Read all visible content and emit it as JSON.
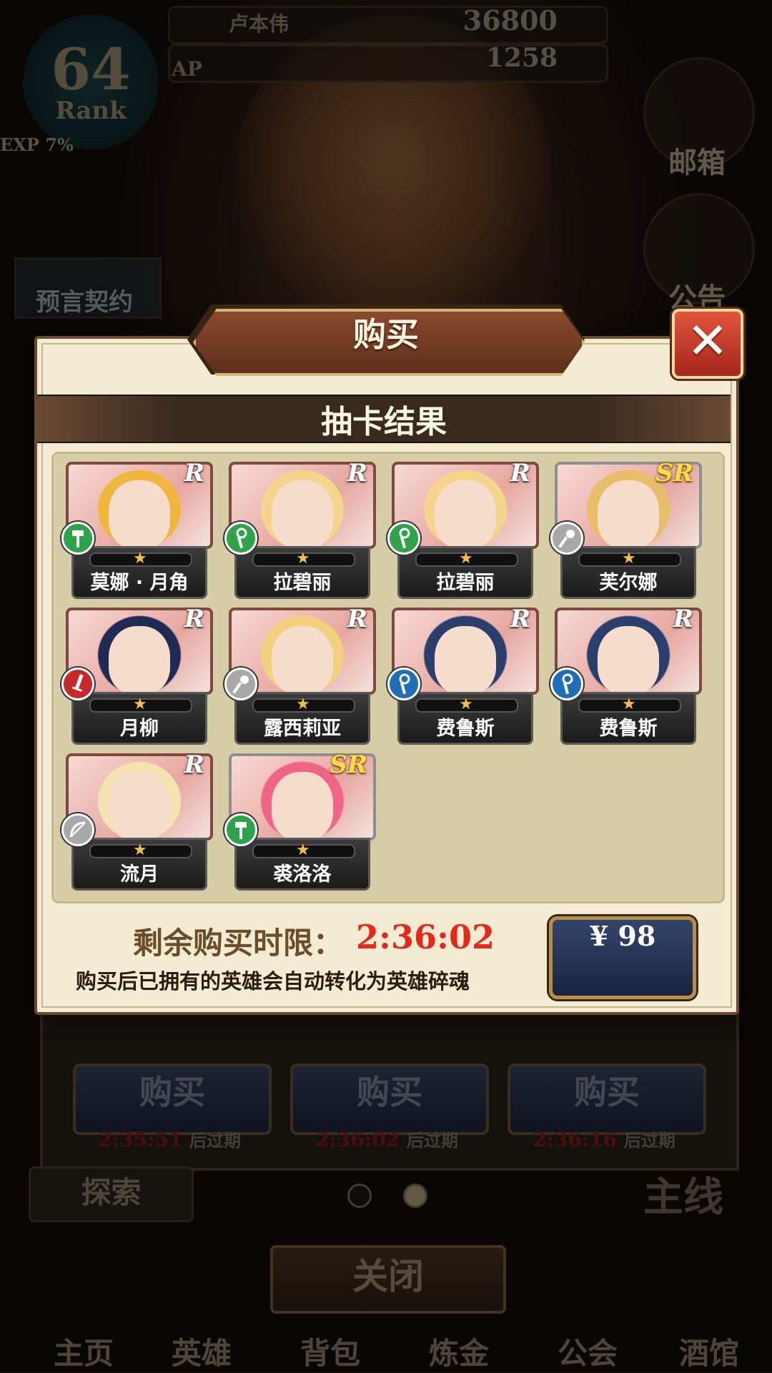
{
  "player": {
    "name": "卢本伟",
    "rank": "64",
    "rank_label": "Rank",
    "exp": "EXP 7%",
    "gold": "36800",
    "gems": "1258",
    "ap_label": "AP"
  },
  "side": {
    "mailbox": "邮箱",
    "notice": "公告",
    "prophecy": "预言契约"
  },
  "dialog": {
    "title": "购买",
    "close_icon": "close-icon",
    "subtitle": "抽卡结果",
    "timer_label": "剩余购买时限：",
    "timer_value": "2:36:02",
    "note": "购买后已拥有的英雄会自动转化为英雄碎魂",
    "price": "¥ 98"
  },
  "cards": [
    {
      "name": "莫娜 · 月角",
      "rarity": "R",
      "class_color": "#2fa34a",
      "class_icon": "hammer-icon",
      "hair": "#f0b63c",
      "stars": 1
    },
    {
      "name": "拉碧丽",
      "rarity": "R",
      "class_color": "#2fa34a",
      "class_icon": "staff-icon",
      "hair": "#f4d58b",
      "stars": 1
    },
    {
      "name": "拉碧丽",
      "rarity": "R",
      "class_color": "#2fa34a",
      "class_icon": "staff-icon",
      "hair": "#f4d58b",
      "stars": 1
    },
    {
      "name": "芙尔娜",
      "rarity": "SR",
      "class_color": "#a8a8a8",
      "class_icon": "mace-icon",
      "hair": "#e8bd6a",
      "stars": 1
    },
    {
      "name": "月柳",
      "rarity": "R",
      "class_color": "#c8282b",
      "class_icon": "sword-icon",
      "hair": "#1f2a55",
      "stars": 1
    },
    {
      "name": "露西莉亚",
      "rarity": "R",
      "class_color": "#a8a8a8",
      "class_icon": "mace-icon",
      "hair": "#f2d07e",
      "stars": 1
    },
    {
      "name": "费鲁斯",
      "rarity": "R",
      "class_color": "#1f6fb8",
      "class_icon": "staff-icon",
      "hair": "#2a3f6e",
      "stars": 1
    },
    {
      "name": "费鲁斯",
      "rarity": "R",
      "class_color": "#1f6fb8",
      "class_icon": "staff-icon",
      "hair": "#2a3f6e",
      "stars": 1
    },
    {
      "name": "流月",
      "rarity": "R",
      "class_color": "#a8a8a8",
      "class_icon": "bow-icon",
      "hair": "#f4e3b0",
      "stars": 1
    },
    {
      "name": "裘洛洛",
      "rarity": "SR",
      "class_color": "#2fa34a",
      "class_icon": "hammer-icon",
      "hair": "#f0648a",
      "stars": 1
    }
  ],
  "under": {
    "buy_label": "购买",
    "offers": [
      {
        "time": "2:35:51",
        "suffix": "后过期"
      },
      {
        "time": "2:36:02",
        "suffix": "后过期"
      },
      {
        "time": "2:36:16",
        "suffix": "后过期"
      }
    ],
    "explore": "探索",
    "mainline": "主线",
    "close": "关闭"
  },
  "nav": [
    "主页",
    "英雄",
    "背包",
    "炼金",
    "公会",
    "酒馆"
  ]
}
